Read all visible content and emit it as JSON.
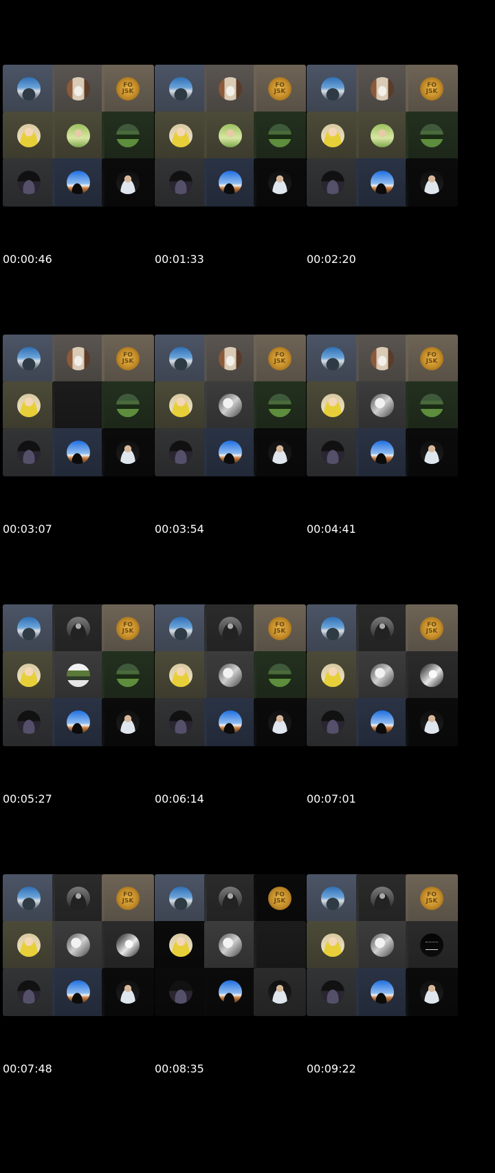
{
  "timestamps": [
    "00:00:46",
    "00:01:33",
    "00:02:20",
    "00:03:07",
    "00:03:54",
    "00:04:41",
    "00:05:27",
    "00:06:14",
    "00:07:01",
    "00:07:48",
    "00:08:35",
    "00:09:22"
  ],
  "palette": {
    "slate": "#4c5566",
    "taupe": "#5a5550",
    "tan": "#6e6456",
    "olive": "#4c4a38",
    "darkgreen": "#23301f",
    "charcoal": "#333436",
    "navy": "#2a3345",
    "black": "#0b0b0b",
    "darkgray": "#2b2b2b",
    "gray": "#3c3c3c",
    "blank": "#1c1c1c"
  },
  "badge_text": "FO\nJSK",
  "tile_kinds": {
    "sky-climber": "sky-climber-avatar-icon",
    "fireplace": "fireplace-avatar-icon",
    "gold-badge": "gold-badge-avatar-icon",
    "yellow-person": "yellow-shirt-person-avatar-icon",
    "green-person": "green-outdoor-person-avatar-icon",
    "green-field": "green-field-avatar-icon",
    "dark-road": "dark-road-avatar-icon",
    "blue-sky": "blue-sky-silhouette-avatar-icon",
    "man-suit": "man-in-suit-avatar-icon",
    "bw-nature": "bw-nature-avatar-icon",
    "dark-figure": "dark-figure-avatar-icon",
    "green-band": "green-band-avatar-icon",
    "bw-portrait": "bw-portrait-avatar-icon",
    "signature": "signature-avatar-icon"
  },
  "frames": [
    {
      "tiles": [
        [
          "sky-climber",
          "slate"
        ],
        [
          "fireplace",
          "taupe"
        ],
        [
          "gold-badge",
          "tan"
        ],
        [
          "yellow-person",
          "olive"
        ],
        [
          "green-person",
          "olive"
        ],
        [
          "green-field",
          "darkgreen"
        ],
        [
          "dark-road",
          "charcoal"
        ],
        [
          "blue-sky",
          "navy"
        ],
        [
          "man-suit",
          "black"
        ]
      ]
    },
    {
      "tiles": [
        [
          "sky-climber",
          "slate"
        ],
        [
          "fireplace",
          "taupe"
        ],
        [
          "gold-badge",
          "tan"
        ],
        [
          "yellow-person",
          "olive"
        ],
        [
          "green-person",
          "olive"
        ],
        [
          "green-field",
          "darkgreen"
        ],
        [
          "dark-road",
          "charcoal"
        ],
        [
          "blue-sky",
          "navy"
        ],
        [
          "man-suit",
          "black"
        ]
      ]
    },
    {
      "tiles": [
        [
          "sky-climber",
          "slate"
        ],
        [
          "fireplace",
          "taupe"
        ],
        [
          "gold-badge",
          "tan"
        ],
        [
          "yellow-person",
          "olive"
        ],
        [
          "green-person",
          "olive"
        ],
        [
          "green-field",
          "darkgreen"
        ],
        [
          "dark-road",
          "charcoal"
        ],
        [
          "blue-sky",
          "navy"
        ],
        [
          "man-suit",
          "black"
        ]
      ]
    },
    {
      "tiles": [
        [
          "sky-climber",
          "slate"
        ],
        [
          "fireplace",
          "taupe"
        ],
        [
          "gold-badge",
          "tan"
        ],
        [
          "yellow-person",
          "olive"
        ],
        [
          "blank",
          "blank"
        ],
        [
          "green-field",
          "darkgreen"
        ],
        [
          "dark-road",
          "charcoal"
        ],
        [
          "blue-sky",
          "navy"
        ],
        [
          "man-suit",
          "black"
        ]
      ]
    },
    {
      "tiles": [
        [
          "sky-climber",
          "slate"
        ],
        [
          "fireplace",
          "taupe"
        ],
        [
          "gold-badge",
          "tan"
        ],
        [
          "yellow-person",
          "olive"
        ],
        [
          "bw-nature",
          "gray"
        ],
        [
          "green-field",
          "darkgreen"
        ],
        [
          "dark-road",
          "charcoal"
        ],
        [
          "blue-sky",
          "navy"
        ],
        [
          "man-suit",
          "black"
        ]
      ]
    },
    {
      "tiles": [
        [
          "sky-climber",
          "slate"
        ],
        [
          "fireplace",
          "taupe"
        ],
        [
          "gold-badge",
          "tan"
        ],
        [
          "yellow-person",
          "olive"
        ],
        [
          "bw-nature",
          "gray"
        ],
        [
          "green-field",
          "darkgreen"
        ],
        [
          "dark-road",
          "charcoal"
        ],
        [
          "blue-sky",
          "navy"
        ],
        [
          "man-suit",
          "black"
        ]
      ]
    },
    {
      "tiles": [
        [
          "sky-climber",
          "slate"
        ],
        [
          "dark-figure",
          "darkgray"
        ],
        [
          "gold-badge",
          "tan"
        ],
        [
          "yellow-person",
          "olive"
        ],
        [
          "green-band",
          "gray"
        ],
        [
          "green-field",
          "darkgreen"
        ],
        [
          "dark-road",
          "charcoal"
        ],
        [
          "blue-sky",
          "navy"
        ],
        [
          "man-suit",
          "black"
        ]
      ]
    },
    {
      "tiles": [
        [
          "sky-climber",
          "slate"
        ],
        [
          "dark-figure",
          "darkgray"
        ],
        [
          "gold-badge",
          "tan"
        ],
        [
          "yellow-person",
          "olive"
        ],
        [
          "bw-nature",
          "gray"
        ],
        [
          "green-field",
          "darkgreen"
        ],
        [
          "dark-road",
          "charcoal"
        ],
        [
          "blue-sky",
          "navy"
        ],
        [
          "man-suit",
          "black"
        ]
      ]
    },
    {
      "tiles": [
        [
          "sky-climber",
          "slate"
        ],
        [
          "dark-figure",
          "darkgray"
        ],
        [
          "gold-badge",
          "tan"
        ],
        [
          "yellow-person",
          "olive"
        ],
        [
          "bw-nature",
          "gray"
        ],
        [
          "bw-portrait",
          "darkgray"
        ],
        [
          "dark-road",
          "charcoal"
        ],
        [
          "blue-sky",
          "navy"
        ],
        [
          "man-suit",
          "black"
        ]
      ]
    },
    {
      "tiles": [
        [
          "sky-climber",
          "slate"
        ],
        [
          "dark-figure",
          "darkgray"
        ],
        [
          "gold-badge",
          "tan"
        ],
        [
          "yellow-person",
          "olive"
        ],
        [
          "bw-nature",
          "gray"
        ],
        [
          "bw-portrait",
          "darkgray"
        ],
        [
          "dark-road",
          "charcoal"
        ],
        [
          "blue-sky",
          "navy"
        ],
        [
          "man-suit",
          "black"
        ]
      ]
    },
    {
      "tiles": [
        [
          "sky-climber",
          "slate"
        ],
        [
          "dark-figure",
          "darkgray"
        ],
        [
          "gold-badge",
          "black"
        ],
        [
          "yellow-person",
          "black"
        ],
        [
          "bw-nature",
          "gray"
        ],
        [
          "blank",
          "blank"
        ],
        [
          "dark-road",
          "black"
        ],
        [
          "blue-sky",
          "black"
        ],
        [
          "man-suit",
          "darkgray"
        ]
      ]
    },
    {
      "tiles": [
        [
          "sky-climber",
          "slate"
        ],
        [
          "dark-figure",
          "darkgray"
        ],
        [
          "gold-badge",
          "tan"
        ],
        [
          "yellow-person",
          "olive"
        ],
        [
          "bw-nature",
          "gray"
        ],
        [
          "signature",
          "darkgray"
        ],
        [
          "dark-road",
          "charcoal"
        ],
        [
          "blue-sky",
          "navy"
        ],
        [
          "man-suit",
          "black"
        ]
      ]
    }
  ]
}
